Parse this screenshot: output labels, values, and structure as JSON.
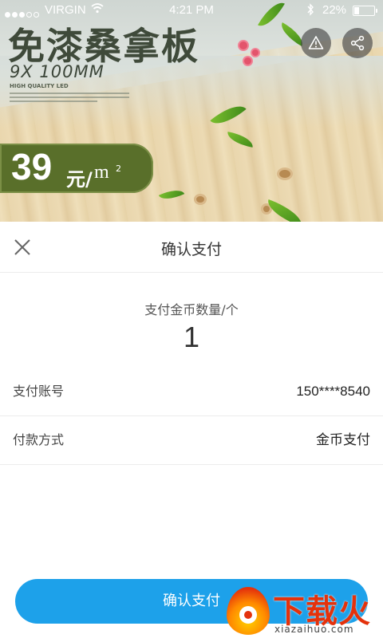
{
  "status_bar": {
    "carrier": "VIRGIN",
    "time": "4:21 PM",
    "battery": "22%"
  },
  "banner": {
    "title": "免漆桑拿板",
    "subtitle": "9X 100MM",
    "tagline": "HIGH QUALITY LED",
    "price": "39",
    "price_unit": "元/",
    "price_area": "m",
    "price_area_sup": "2",
    "icons": [
      "warning-icon",
      "share-icon"
    ]
  },
  "sheet": {
    "title": "确认支付",
    "amount_label": "支付金币数量/个",
    "amount_value": "1",
    "rows": [
      {
        "label": "支付账号",
        "value": "150****8540"
      },
      {
        "label": "付款方式",
        "value": "金币支付"
      }
    ],
    "confirm_label": "确认支付"
  },
  "watermark": {
    "brand": "下载火",
    "url": "xiazaihuo.com"
  },
  "colors": {
    "accent": "#1da1ea",
    "price_tag": "#596f2a"
  }
}
